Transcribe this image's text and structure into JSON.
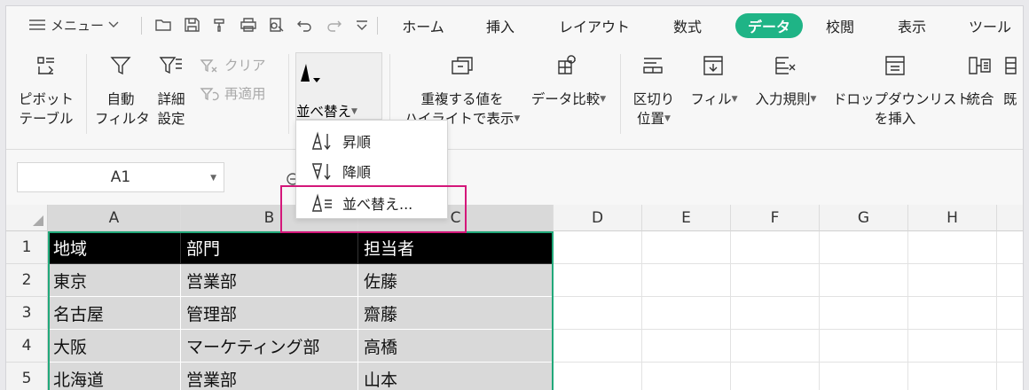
{
  "quick_access": {
    "menu_label": "メニュー",
    "icons": [
      "hamburger-icon",
      "chevron-down-icon",
      "open-folder-icon",
      "save-icon",
      "format-painter-icon",
      "print-icon",
      "print-preview-icon",
      "undo-icon",
      "redo-icon",
      "customize-icon"
    ]
  },
  "tabs": [
    "ホーム",
    "挿入",
    "レイアウト",
    "数式",
    "データ",
    "校閲",
    "表示",
    "ツール"
  ],
  "active_tab": "データ",
  "ribbon": {
    "pivot": [
      "ピボット",
      "テーブル"
    ],
    "autofilter": [
      "自動",
      "フィルタ"
    ],
    "advanced": [
      "詳細",
      "設定"
    ],
    "clear": "クリア",
    "reapply": "再適用",
    "sort": "並べ替え",
    "highlight_dup": [
      "重複する値を",
      "ハイライトで表示"
    ],
    "compare": "データ比較",
    "text_to_columns": [
      "区切り",
      "位置"
    ],
    "fill": "フィル",
    "validation": "入力規則",
    "dropdown_list": [
      "ドロップダウンリスト",
      "を挿入"
    ],
    "consolidate": "統合",
    "partial_next": "既"
  },
  "sort_menu": {
    "ascending": "昇順",
    "descending": "降順",
    "custom": "並べ替え..."
  },
  "namebox": "A1",
  "columns": [
    "A",
    "B",
    "C",
    "D",
    "E",
    "F",
    "G",
    "H"
  ],
  "rows": [
    "1",
    "2",
    "3",
    "4",
    "5"
  ],
  "table": {
    "header": [
      "地域",
      "部門",
      "担当者"
    ],
    "data": [
      [
        "東京",
        "営業部",
        "佐藤"
      ],
      [
        "名古屋",
        "管理部",
        "齋藤"
      ],
      [
        "大阪",
        "マーケティング部",
        "高橋"
      ],
      [
        "北海道",
        "営業部",
        "山本"
      ]
    ]
  },
  "colors": {
    "accent": "#1fb486",
    "selection_border": "#22a97a",
    "highlight_box": "#d4177a"
  }
}
